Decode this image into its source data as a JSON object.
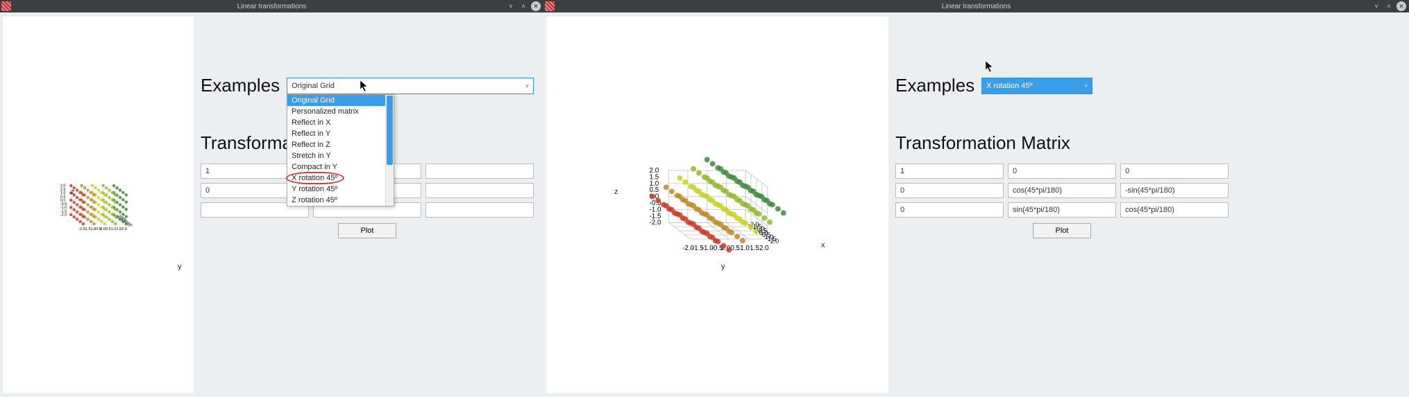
{
  "window_title": "Linear transformations",
  "titlebar_buttons": {
    "min": "˅",
    "max": "˄",
    "close": "✕"
  },
  "left": {
    "examples_label": "Examples",
    "combo_value": "Original Grid",
    "dropdown": [
      "Original Grid",
      "Personalized matrix",
      "Reflect in X",
      "Reflect in Y",
      "Reflect in Z",
      "Stretch in Y",
      "Compact in Y",
      "X rotation 45º",
      "Y rotation 45º",
      "Z rotation 45º"
    ],
    "matrix_label_partial": "Transforma",
    "matrix": [
      [
        "1",
        "",
        ""
      ],
      [
        "0",
        "",
        ""
      ],
      [
        "",
        "",
        ""
      ]
    ],
    "plot_label": "Plot"
  },
  "right": {
    "examples_label": "Examples",
    "combo_value": "X rotation 45º",
    "matrix_label": "Transformation Matrix",
    "matrix": [
      [
        "1",
        "0",
        "0"
      ],
      [
        "0",
        "cos(45*pi/180)",
        "-sin(45*pi/180)"
      ],
      [
        "0",
        "sin(45*pi/180)",
        "cos(45*pi/180)"
      ]
    ],
    "plot_label": "Plot"
  },
  "axes": {
    "z_label": "z",
    "y_label": "y",
    "x_label": "x",
    "z_ticks": [
      "2.0",
      "1.5",
      "1.0",
      "0.5",
      "0.0",
      "-0.5",
      "-1.0",
      "-1.5",
      "-2.0"
    ],
    "y_ticks": [
      "-2.0",
      "-1.5",
      "-1.0",
      "-0.5",
      "0.0",
      "0.5",
      "1.0",
      "1.5",
      "2.0"
    ],
    "x_ticks": [
      "-2.0",
      "-1.5",
      "-1.0",
      "-0.5",
      "0.0",
      "0.5",
      "1.0",
      "1.5",
      "2.0"
    ]
  },
  "chart_data": [
    {
      "type": "scatter",
      "title": "Original Grid",
      "xlabel": "y",
      "ylabel": "z",
      "zlabel": "x",
      "xlim": [
        -2,
        2
      ],
      "ylim": [
        -2,
        2
      ],
      "zlim": [
        -2,
        2
      ],
      "note": "5x5x5 integer lattice from -2..2, untransformed"
    },
    {
      "type": "scatter",
      "title": "X rotation 45º",
      "xlabel": "y",
      "ylabel": "z",
      "zlabel": "x",
      "xlim": [
        -2,
        2
      ],
      "ylim": [
        -2,
        2
      ],
      "zlim": [
        -2,
        2
      ],
      "note": "5x5x5 integer lattice rotated 45º about X axis",
      "matrix": [
        [
          1,
          0,
          0
        ],
        [
          0,
          0.7071,
          -0.7071
        ],
        [
          0,
          0.7071,
          0.7071
        ]
      ]
    }
  ]
}
